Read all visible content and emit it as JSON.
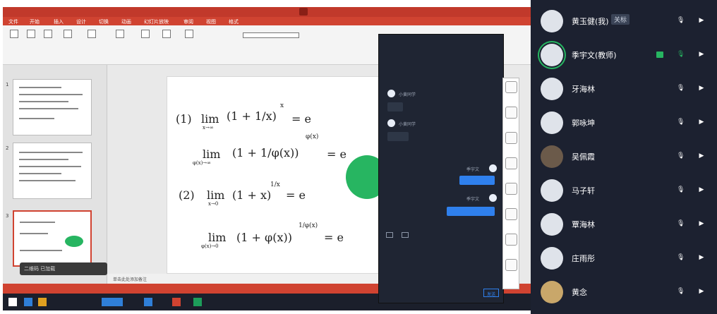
{
  "participants": [
    {
      "name": "黄玉健(我)",
      "tag": "关标",
      "ring": false,
      "green": false,
      "screen": false
    },
    {
      "name": "季宇文(教师)",
      "tag": "",
      "ring": true,
      "green": true,
      "screen": true
    },
    {
      "name": "牙海林",
      "tag": "",
      "ring": false,
      "green": false,
      "screen": false
    },
    {
      "name": "郭咏坤",
      "tag": "",
      "ring": false,
      "green": false,
      "screen": false
    },
    {
      "name": "吴佩霞",
      "tag": "",
      "ring": false,
      "green": false,
      "screen": false,
      "photo": true
    },
    {
      "name": "马子轩",
      "tag": "",
      "ring": false,
      "green": false,
      "screen": false
    },
    {
      "name": "覃海林",
      "tag": "",
      "ring": false,
      "green": false,
      "screen": false
    },
    {
      "name": "庄雨彤",
      "tag": "",
      "ring": false,
      "green": false,
      "screen": false
    },
    {
      "name": "黄念",
      "tag": "",
      "ring": false,
      "green": false,
      "screen": false,
      "photo2": true
    }
  ],
  "icons": {
    "mic": "microphone-icon",
    "cam": "camera-icon",
    "screen": "screen-share-icon"
  },
  "colors": {
    "accent": "#27b561",
    "panel": "#1c2130",
    "ppt_red": "#d04331",
    "chat_blue": "#2f80ed"
  },
  "ppt": {
    "menu": [
      "文件",
      "开始",
      "插入",
      "设计",
      "切换",
      "动画",
      "幻灯片放映",
      "审阅",
      "视图",
      "格式"
    ],
    "notes_hint": "单击此处添加备注",
    "pill": "二维码  已加载",
    "slide_numbers": [
      "1",
      "2",
      "3"
    ],
    "formula": {
      "label1": "(1)",
      "label2": "(2)",
      "lim": "lim",
      "f1": "(1 + 1/x)",
      "f1_exp": "x",
      "f1_sub": "x→∞",
      "f2_sub": "φ(x)→∞",
      "f2": "(1 + 1/φ(x))",
      "f2_exp": "φ(x)",
      "eq": "= e",
      "f3": "(1 + x)",
      "f3_exp": "1/x",
      "f3_sub": "x→0",
      "f4": "(1 + φ(x))",
      "f4_exp": "1/φ(x)",
      "f4_sub": "φ(x)→0"
    }
  },
  "chat": {
    "send": "发送",
    "messages": [
      {
        "side": "in",
        "name": "小黄同学"
      },
      {
        "side": "in",
        "name": "小黄同学"
      },
      {
        "side": "out",
        "name": "季宇文"
      },
      {
        "side": "out",
        "name": "季宇文"
      }
    ]
  }
}
